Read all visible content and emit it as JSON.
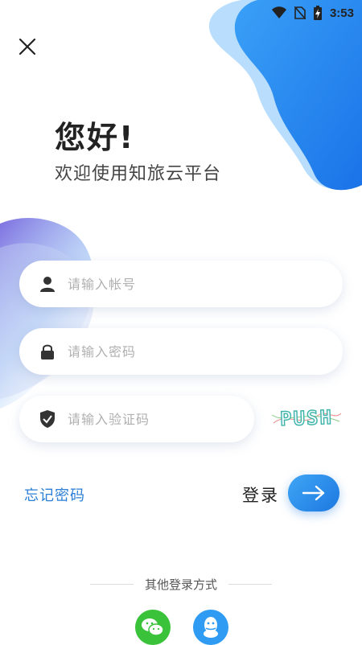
{
  "status_bar": {
    "time": "3:53",
    "icons": [
      "wifi-icon",
      "no-sim-icon",
      "battery-charging-icon"
    ]
  },
  "header": {
    "close_icon": "close-icon"
  },
  "greeting": {
    "title": "您好!",
    "subtitle": "欢迎使用知旅云平台"
  },
  "form": {
    "account": {
      "placeholder": "请输入帐号",
      "value": "",
      "icon": "user-icon"
    },
    "password": {
      "placeholder": "请输入密码",
      "value": "",
      "icon": "lock-icon"
    },
    "captcha": {
      "placeholder": "请输入验证码",
      "value": "",
      "icon": "shield-icon",
      "captcha_text": "PUSH"
    }
  },
  "actions": {
    "forgot_label": "忘记密码",
    "login_label": "登录"
  },
  "other_login": {
    "label": "其他登录方式",
    "providers": [
      "wechat",
      "qq"
    ]
  },
  "colors": {
    "accent": "#2b7fd6",
    "button_start": "#3fa6f5",
    "button_end": "#1d78e0",
    "wechat": "#3bc23b",
    "qq": "#2f9bf2"
  }
}
